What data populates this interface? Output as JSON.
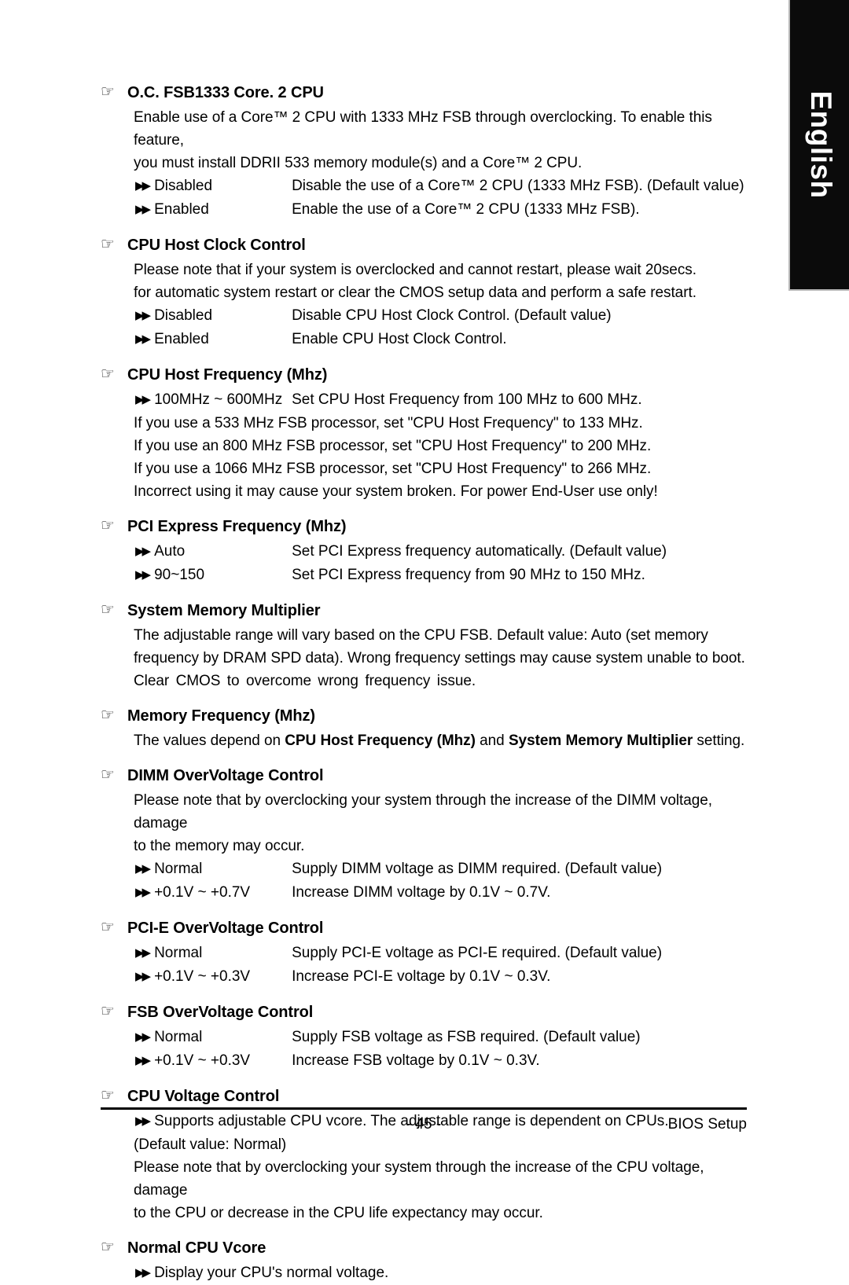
{
  "language_tab": {
    "label": "English"
  },
  "icons": {
    "heading_bullet": "pointing-hand-icon",
    "option_bullet": "double-triangle-right-icon"
  },
  "sections": [
    {
      "id": "oc-fsb1333",
      "title": "O.C. FSB1333 Core. 2 CPU",
      "paragraphs": [
        "Enable use of a Core™ 2 CPU with 1333 MHz FSB through overclocking.  To enable this feature,",
        "you must install DDRII 533 memory module(s) and a Core™ 2 CPU."
      ],
      "options": [
        {
          "label": "Disabled",
          "desc": "Disable the use of a Core™ 2 CPU (1333 MHz FSB). (Default value)"
        },
        {
          "label": "Enabled",
          "desc": "Enable the use of a Core™ 2 CPU (1333 MHz FSB)."
        }
      ]
    },
    {
      "id": "cpu-host-clock-control",
      "title": "CPU Host Clock Control",
      "paragraphs": [
        "Please note that if your system is overclocked and cannot restart, please wait 20secs.",
        "for automatic system restart or clear the CMOS setup data and perform a safe restart."
      ],
      "options": [
        {
          "label": "Disabled",
          "desc": "Disable CPU Host Clock Control. (Default value)"
        },
        {
          "label": "Enabled",
          "desc": "Enable CPU Host Clock Control."
        }
      ]
    },
    {
      "id": "cpu-host-frequency",
      "title": "CPU Host Frequency (Mhz)",
      "options": [
        {
          "label": "100MHz ~ 600MHz",
          "desc": "Set CPU Host Frequency from 100 MHz to 600 MHz."
        }
      ],
      "paragraphs_after": [
        "If you use a 533 MHz FSB processor, set \"CPU Host Frequency\" to 133 MHz.",
        "If you use an 800 MHz FSB processor, set \"CPU Host Frequency\" to 200 MHz.",
        "If you use a 1066 MHz FSB processor, set \"CPU Host Frequency\" to 266 MHz.",
        "Incorrect using it may cause your system broken. For power End-User use only!"
      ]
    },
    {
      "id": "pci-express-frequency",
      "title": "PCI Express Frequency (Mhz)",
      "options": [
        {
          "label": "Auto",
          "desc": "Set PCI Express frequency automatically. (Default value)"
        },
        {
          "label": "90~150",
          "desc": "Set PCI Express frequency from 90 MHz to 150 MHz."
        }
      ]
    },
    {
      "id": "system-memory-multiplier",
      "title": "System Memory Multiplier",
      "paragraphs": [
        "The adjustable range will vary based on the CPU FSB. Default value: Auto (set memory",
        "frequency by DRAM SPD data). Wrong frequency settings may cause system unable to boot.",
        "Clear CMOS to overcome wrong frequency issue."
      ]
    },
    {
      "id": "memory-frequency",
      "title": "Memory Frequency (Mhz)",
      "rich_paragraph": {
        "pre": "The values depend on ",
        "bold1": "CPU Host Frequency (Mhz)",
        "mid": " and ",
        "bold2": "System Memory Multiplier",
        "post": " setting."
      }
    },
    {
      "id": "dimm-overvoltage-control",
      "title": "DIMM OverVoltage Control",
      "paragraphs": [
        "Please note that by overclocking your system through the increase of the DIMM voltage, damage",
        "to the memory may occur."
      ],
      "options": [
        {
          "label": "Normal",
          "desc": "Supply DIMM voltage as DIMM required. (Default value)"
        },
        {
          "label": "+0.1V ~ +0.7V",
          "desc": "Increase DIMM voltage by 0.1V ~ 0.7V."
        }
      ]
    },
    {
      "id": "pci-e-overvoltage-control",
      "title": "PCI-E OverVoltage Control",
      "options": [
        {
          "label": "Normal",
          "desc": "Supply PCI-E voltage as PCI-E required. (Default value)"
        },
        {
          "label": "+0.1V ~ +0.3V",
          "desc": "Increase PCI-E voltage by 0.1V ~ 0.3V."
        }
      ]
    },
    {
      "id": "fsb-overvoltage-control",
      "title": "FSB OverVoltage Control",
      "options": [
        {
          "label": "Normal",
          "desc": "Supply FSB voltage as FSB required. (Default value)"
        },
        {
          "label": "+0.1V ~ +0.3V",
          "desc": "Increase FSB voltage by 0.1V ~ 0.3V."
        }
      ]
    },
    {
      "id": "cpu-voltage-control",
      "title": "CPU Voltage Control",
      "single_options": [
        "Supports adjustable CPU vcore. The adjustable range is dependent on CPUs."
      ],
      "paragraphs_after": [
        "(Default value: Normal)",
        "Please note that by overclocking your system through the increase of the CPU voltage, damage",
        "to the CPU or decrease in the CPU life expectancy may occur."
      ]
    },
    {
      "id": "normal-cpu-vcore",
      "title": "Normal CPU Vcore",
      "single_options": [
        "Display your CPU's normal voltage."
      ]
    }
  ],
  "footer": {
    "page_number": "- 45 -",
    "right_label": "BIOS Setup"
  }
}
